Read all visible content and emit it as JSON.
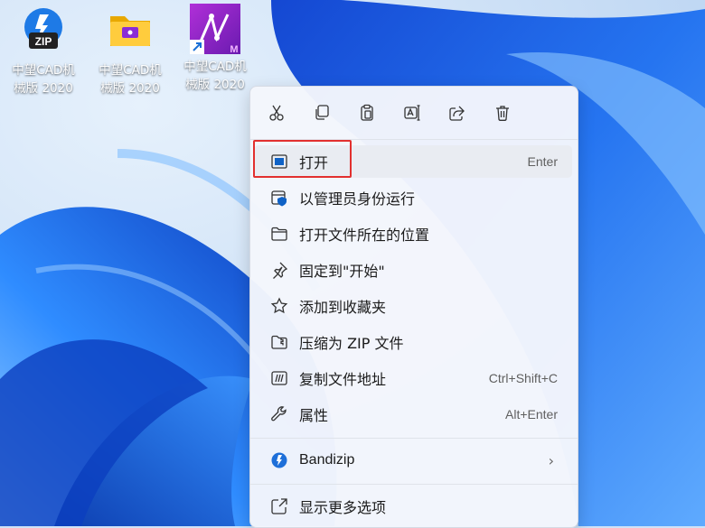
{
  "desktop": {
    "icons": [
      {
        "label": "中望CAD机\n械版 2020",
        "icon": "bandizip-zip-icon",
        "badge": "ZIP"
      },
      {
        "label": "中望CAD机\n械版 2020",
        "icon": "folder-icon"
      },
      {
        "label": "中望CAD机\n械版 2020",
        "icon": "zwcad-mechanical-icon",
        "corner_letter": "M"
      }
    ]
  },
  "context_menu": {
    "toolbar": [
      {
        "name": "cut",
        "icon": "scissors-icon"
      },
      {
        "name": "copy",
        "icon": "copy-icon"
      },
      {
        "name": "paste",
        "icon": "clipboard-icon"
      },
      {
        "name": "rename",
        "icon": "rename-icon"
      },
      {
        "name": "share",
        "icon": "share-icon"
      },
      {
        "name": "delete",
        "icon": "trash-icon"
      }
    ],
    "items": [
      {
        "label": "打开",
        "shortcut": "Enter",
        "icon": "open-window-icon"
      },
      {
        "label": "以管理员身份运行",
        "shortcut": "",
        "icon": "shield-window-icon"
      },
      {
        "label": "打开文件所在的位置",
        "shortcut": "",
        "icon": "folder-outline-icon"
      },
      {
        "label": "固定到\"开始\"",
        "shortcut": "",
        "icon": "pin-icon"
      },
      {
        "label": "添加到收藏夹",
        "shortcut": "",
        "icon": "star-icon"
      },
      {
        "label": "压缩为 ZIP 文件",
        "shortcut": "",
        "icon": "zip-folder-icon"
      },
      {
        "label": "复制文件地址",
        "shortcut": "Ctrl+Shift+C",
        "icon": "copy-path-icon"
      },
      {
        "label": "属性",
        "shortcut": "Alt+Enter",
        "icon": "wrench-icon"
      },
      {
        "label": "Bandizip",
        "shortcut": "",
        "icon": "bandizip-icon",
        "submenu": true
      },
      {
        "label": "显示更多选项",
        "shortcut": "",
        "icon": "more-options-icon"
      }
    ]
  },
  "colors": {
    "accent": "#0067c0",
    "highlight_box": "#e2302f",
    "wallpaper_blue": "#1a5fe0"
  }
}
